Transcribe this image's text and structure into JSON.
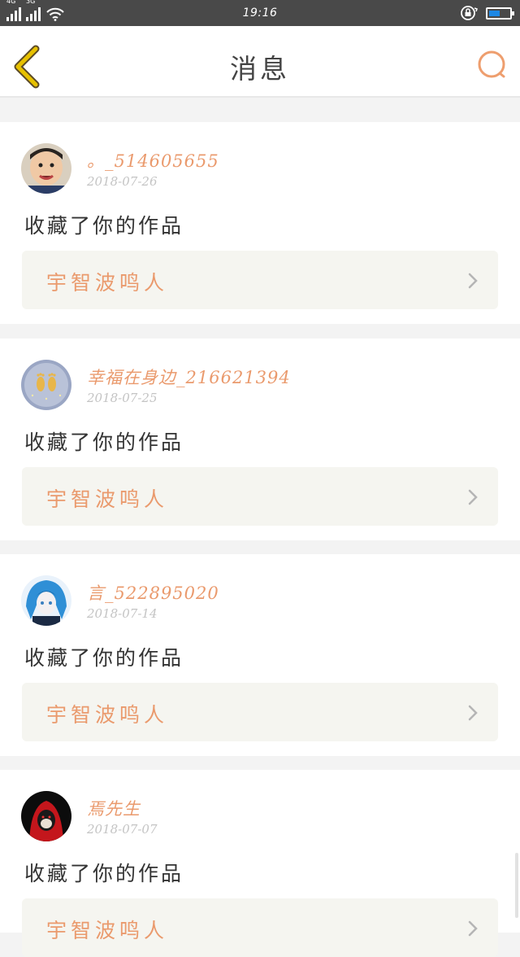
{
  "status_bar": {
    "network_1": "4G",
    "network_2": "3G",
    "time": "19:16",
    "battery_level": 0.45
  },
  "header": {
    "back_icon": "chevron-left-icon",
    "title": "消息",
    "search_icon": "search-icon"
  },
  "colors": {
    "accent": "#ea9a6d",
    "back_icon": "#e7c100",
    "card_bg": "#ffffff",
    "work_bg": "#f5f5f0"
  },
  "messages": [
    {
      "username": "。_514605655",
      "date": "2018-07-26",
      "action": "收藏了你的作品",
      "work_title": "宇智波鸣人",
      "avatar": "child-photo-avatar"
    },
    {
      "username": "幸福在身边_216621394",
      "date": "2018-07-25",
      "action": "收藏了你的作品",
      "work_title": "宇智波鸣人",
      "avatar": "footprints-avatar"
    },
    {
      "username": "言_522895020",
      "date": "2018-07-14",
      "action": "收藏了你的作品",
      "work_title": "宇智波鸣人",
      "avatar": "anime-blue-hair-avatar"
    },
    {
      "username": "焉先生",
      "date": "2018-07-07",
      "action": "收藏了你的作品",
      "work_title": "宇智波鸣人",
      "avatar": "red-hood-avatar"
    }
  ]
}
